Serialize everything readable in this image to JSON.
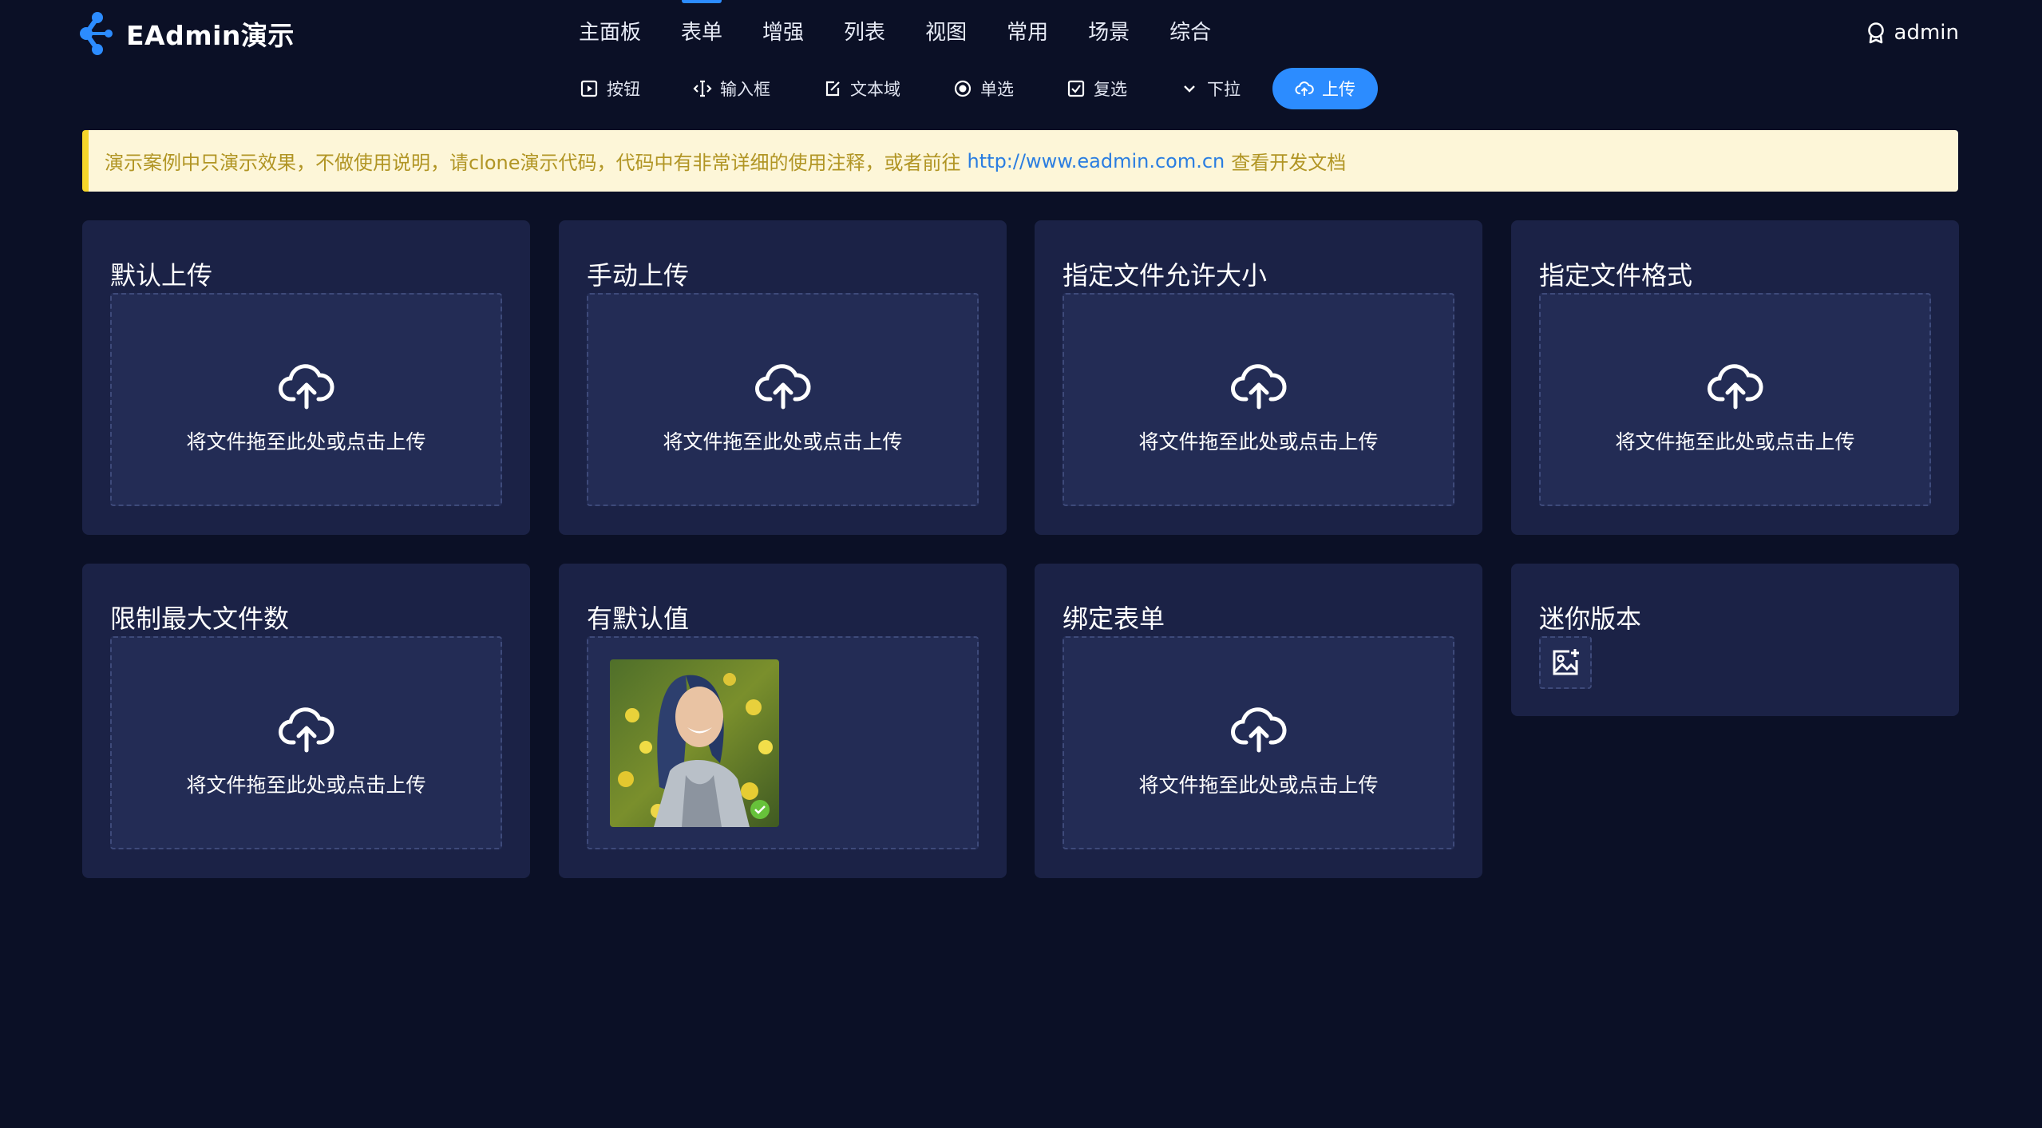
{
  "app": {
    "title": "EAdmin演示"
  },
  "main_nav": [
    "主面板",
    "表单",
    "增强",
    "列表",
    "视图",
    "常用",
    "场景",
    "综合"
  ],
  "main_nav_active": 1,
  "user": {
    "name": "admin"
  },
  "sub_nav": [
    {
      "label": "按钮",
      "icon": "play-square-icon"
    },
    {
      "label": "输入框",
      "icon": "input-cursor-icon"
    },
    {
      "label": "文本域",
      "icon": "edit-form-icon"
    },
    {
      "label": "单选",
      "icon": "radio-icon"
    },
    {
      "label": "复选",
      "icon": "checkbox-icon"
    },
    {
      "label": "下拉",
      "icon": "chevron-down-icon"
    },
    {
      "label": "上传",
      "icon": "cloud-upload-icon",
      "active": true
    }
  ],
  "notice": {
    "text_before": "演示案例中只演示效果，不做使用说明，请clone演示代码，代码中有非常详细的使用注释，或者前往",
    "link": "http://www.eadmin.com.cn",
    "text_after": "查看开发文档"
  },
  "upload_hint": "将文件拖至此处或点击上传",
  "cards": [
    {
      "title": "默认上传"
    },
    {
      "title": "手动上传"
    },
    {
      "title": "指定文件允许大小"
    },
    {
      "title": "指定文件格式"
    },
    {
      "title": "限制最大文件数"
    },
    {
      "title": "有默认值"
    },
    {
      "title": "绑定表单"
    },
    {
      "title": "迷你版本"
    }
  ],
  "colors": {
    "background": "#0b1026",
    "card": "#1b2246",
    "accent": "#2c8cff",
    "notice_bg": "#fdf6d8",
    "notice_text": "#b19524",
    "link": "#2a7de1"
  }
}
